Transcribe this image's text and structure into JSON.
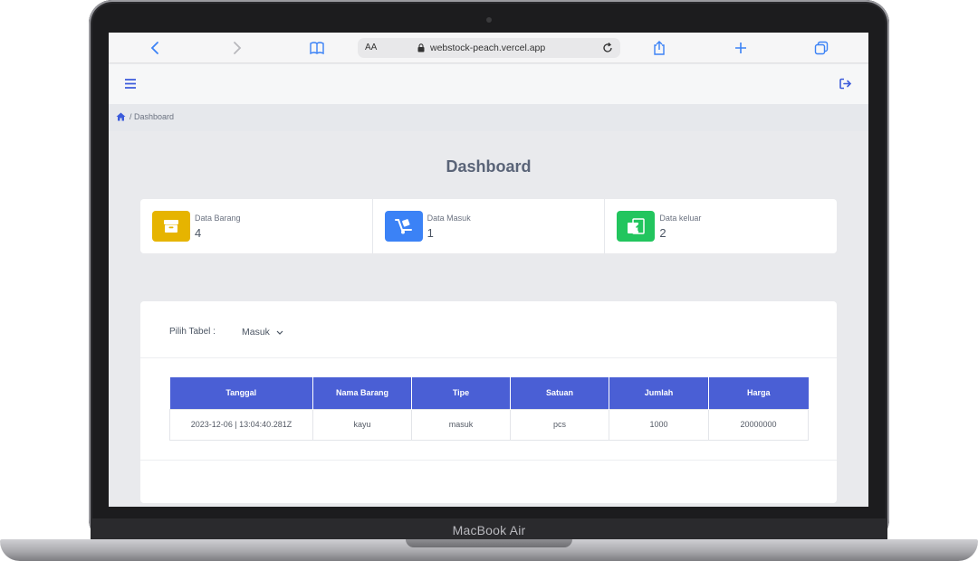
{
  "device": {
    "label": "MacBook Air"
  },
  "browser": {
    "text_size": "AA",
    "url": "webstock-peach.vercel.app"
  },
  "breadcrumb": {
    "current": "/ Dashboard"
  },
  "page": {
    "title": "Dashboard"
  },
  "stats": [
    {
      "label": "Data Barang",
      "value": "4",
      "color": "#e6b400",
      "icon": "box-icon"
    },
    {
      "label": "Data Masuk",
      "value": "1",
      "color": "#3b82f6",
      "icon": "dolly-icon"
    },
    {
      "label": "Data keluar",
      "value": "2",
      "color": "#22c55e",
      "icon": "dispatch-box-icon"
    }
  ],
  "table_selector": {
    "label": "Pilih Tabel :",
    "selected": "Masuk"
  },
  "table": {
    "headers": [
      "Tanggal",
      "Nama Barang",
      "Tipe",
      "Satuan",
      "Jumlah",
      "Harga"
    ],
    "rows": [
      [
        "2023-12-06 | 13:04:40.281Z",
        "kayu",
        "masuk",
        "pcs",
        "1000",
        "20000000"
      ]
    ]
  },
  "colors": {
    "accent": "#4a5fd5",
    "icon_blue": "#3b5bdb"
  }
}
